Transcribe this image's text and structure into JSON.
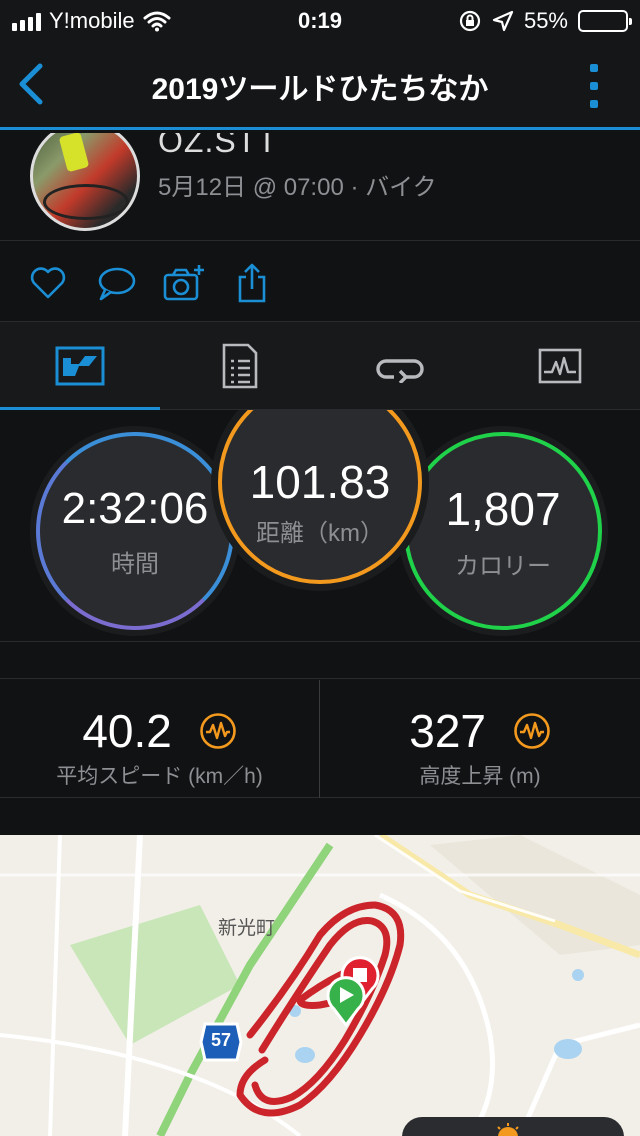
{
  "status_bar": {
    "carrier": "Y!mobile",
    "time": "0:19",
    "battery_percent": "55%",
    "battery_level": 0.55,
    "icons": [
      "signal-icon",
      "wifi-icon",
      "orientation-lock-icon",
      "location-arrow-icon",
      "battery-icon"
    ]
  },
  "nav": {
    "title": "2019ツールドひたちなか",
    "back_icon": "chevron-left-icon",
    "more_icon": "vertical-ellipsis-icon"
  },
  "activity": {
    "username": "OZ.STT",
    "meta": "5月12日 @ 07:00 · バイク"
  },
  "actions": [
    {
      "name": "like-icon"
    },
    {
      "name": "comment-icon"
    },
    {
      "name": "add-photo-icon"
    },
    {
      "name": "share-icon"
    }
  ],
  "tabs": [
    {
      "name": "tab-stats",
      "icon": "stats-icon",
      "active": true
    },
    {
      "name": "tab-details",
      "icon": "details-list-icon",
      "active": false
    },
    {
      "name": "tab-laps",
      "icon": "laps-loop-icon",
      "active": false
    },
    {
      "name": "tab-charts",
      "icon": "chart-graph-icon",
      "active": false
    }
  ],
  "summary": {
    "time": {
      "value": "2:32:06",
      "label": "時間"
    },
    "distance": {
      "value": "101.83",
      "label": "距離（km）"
    },
    "calories": {
      "value": "1,807",
      "label": "カロリー"
    }
  },
  "details": {
    "avg_speed": {
      "value": "40.2",
      "label": "平均スピード (km／h)"
    },
    "elevation_gain": {
      "value": "327",
      "label": "高度上昇 (m)"
    }
  },
  "map": {
    "place_label": "新光町",
    "route_badge": "57"
  },
  "colors": {
    "accent": "#1a8fd6",
    "time_ring": "#3b8fd9",
    "distance_ring": "#f39a1e",
    "calories_ring": "#1fd24a",
    "route": "#c8131b"
  }
}
